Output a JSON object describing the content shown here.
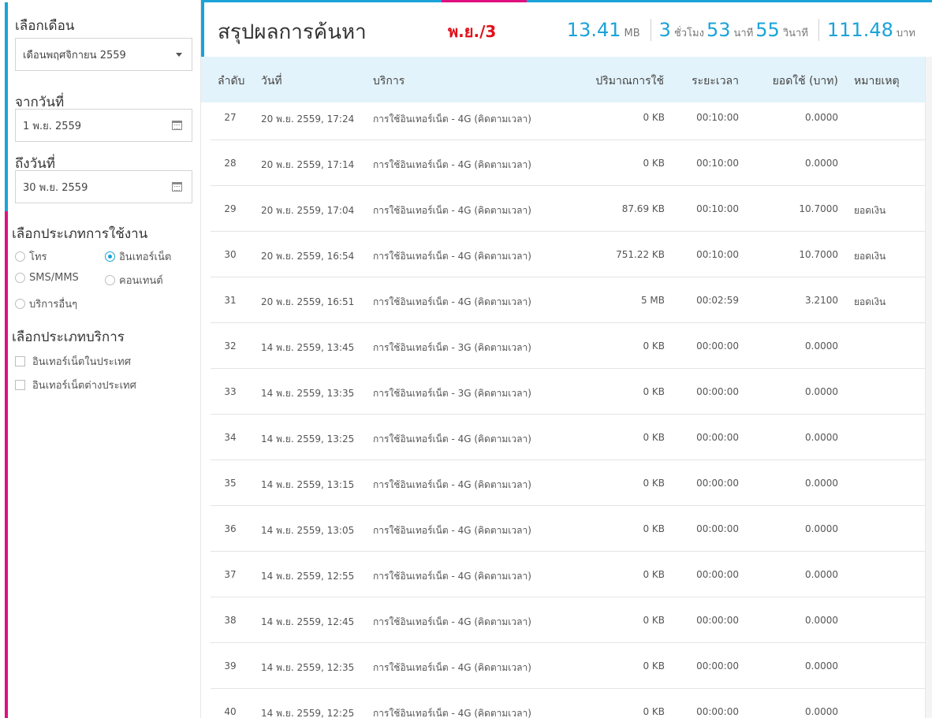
{
  "sidebar": {
    "month_label": "เลือกเดือน",
    "month_value": "เดือนพฤศจิกายน 2559",
    "from_label": "จากวันที่",
    "from_value": "1 พ.ย. 2559",
    "to_label": "ถึงวันที่",
    "to_value": "30 พ.ย. 2559",
    "usage_type_label": "เลือกประเภทการใช้งาน",
    "usage_types": [
      {
        "label": "โทร",
        "selected": false
      },
      {
        "label": "อินเทอร์เน็ต",
        "selected": true
      },
      {
        "label": "SMS/MMS",
        "selected": false
      },
      {
        "label": "คอนเทนต์",
        "selected": false
      },
      {
        "label": "บริการอื่นๆ",
        "selected": false
      }
    ],
    "service_type_label": "เลือกประเภทบริการ",
    "service_types": [
      {
        "label": "อินเทอร์เน็ตในประเทศ",
        "checked": false
      },
      {
        "label": "อินเทอร์เน็ตต่างประเทศ",
        "checked": false
      }
    ]
  },
  "header": {
    "title": "สรุปผลการค้นหา",
    "month_tag": "พ.ย./3",
    "data_value": "13.41",
    "data_unit": "MB",
    "hours_value": "3",
    "hours_unit": "ชั่วโมง",
    "minutes_value": "53",
    "minutes_unit": "นาที",
    "seconds_value": "55",
    "seconds_unit": "วินาที",
    "cost_value": "111.48",
    "cost_unit": "บาท"
  },
  "table": {
    "headers": {
      "no": "ลำดับ",
      "date": "วันที่",
      "service": "บริการ",
      "amount": "ปริมาณการใช้",
      "duration": "ระยะเวลา",
      "cost": "ยอดใช้ (บาท)",
      "note": "หมายเหตุ"
    },
    "rows": [
      {
        "no": "27",
        "date": "20 พ.ย. 2559, 17:24",
        "service": "การใช้อินเทอร์เน็ต - 4G (คิดตามเวลา)",
        "amount": "0 KB",
        "duration": "00:10:00",
        "cost": "0.0000",
        "note": ""
      },
      {
        "no": "28",
        "date": "20 พ.ย. 2559, 17:14",
        "service": "การใช้อินเทอร์เน็ต - 4G (คิดตามเวลา)",
        "amount": "0 KB",
        "duration": "00:10:00",
        "cost": "0.0000",
        "note": ""
      },
      {
        "no": "29",
        "date": "20 พ.ย. 2559, 17:04",
        "service": "การใช้อินเทอร์เน็ต - 4G (คิดตามเวลา)",
        "amount": "87.69 KB",
        "duration": "00:10:00",
        "cost": "10.7000",
        "note": "ยอดเงิน"
      },
      {
        "no": "30",
        "date": "20 พ.ย. 2559, 16:54",
        "service": "การใช้อินเทอร์เน็ต - 4G (คิดตามเวลา)",
        "amount": "751.22 KB",
        "duration": "00:10:00",
        "cost": "10.7000",
        "note": "ยอดเงิน"
      },
      {
        "no": "31",
        "date": "20 พ.ย. 2559, 16:51",
        "service": "การใช้อินเทอร์เน็ต - 4G (คิดตามเวลา)",
        "amount": "5 MB",
        "duration": "00:02:59",
        "cost": "3.2100",
        "note": "ยอดเงิน"
      },
      {
        "no": "32",
        "date": "14 พ.ย. 2559, 13:45",
        "service": "การใช้อินเทอร์เน็ต - 3G (คิดตามเวลา)",
        "amount": "0 KB",
        "duration": "00:00:00",
        "cost": "0.0000",
        "note": ""
      },
      {
        "no": "33",
        "date": "14 พ.ย. 2559, 13:35",
        "service": "การใช้อินเทอร์เน็ต - 3G (คิดตามเวลา)",
        "amount": "0 KB",
        "duration": "00:00:00",
        "cost": "0.0000",
        "note": ""
      },
      {
        "no": "34",
        "date": "14 พ.ย. 2559, 13:25",
        "service": "การใช้อินเทอร์เน็ต - 4G (คิดตามเวลา)",
        "amount": "0 KB",
        "duration": "00:00:00",
        "cost": "0.0000",
        "note": ""
      },
      {
        "no": "35",
        "date": "14 พ.ย. 2559, 13:15",
        "service": "การใช้อินเทอร์เน็ต - 4G (คิดตามเวลา)",
        "amount": "0 KB",
        "duration": "00:00:00",
        "cost": "0.0000",
        "note": ""
      },
      {
        "no": "36",
        "date": "14 พ.ย. 2559, 13:05",
        "service": "การใช้อินเทอร์เน็ต - 4G (คิดตามเวลา)",
        "amount": "0 KB",
        "duration": "00:00:00",
        "cost": "0.0000",
        "note": ""
      },
      {
        "no": "37",
        "date": "14 พ.ย. 2559, 12:55",
        "service": "การใช้อินเทอร์เน็ต - 4G (คิดตามเวลา)",
        "amount": "0 KB",
        "duration": "00:00:00",
        "cost": "0.0000",
        "note": ""
      },
      {
        "no": "38",
        "date": "14 พ.ย. 2559, 12:45",
        "service": "การใช้อินเทอร์เน็ต - 4G (คิดตามเวลา)",
        "amount": "0 KB",
        "duration": "00:00:00",
        "cost": "0.0000",
        "note": ""
      },
      {
        "no": "39",
        "date": "14 พ.ย. 2559, 12:35",
        "service": "การใช้อินเทอร์เน็ต - 4G (คิดตามเวลา)",
        "amount": "0 KB",
        "duration": "00:00:00",
        "cost": "0.0000",
        "note": ""
      },
      {
        "no": "40",
        "date": "14 พ.ย. 2559, 12:25",
        "service": "การใช้อินเทอร์เน็ต - 4G (คิดตามเวลา)",
        "amount": "0 KB",
        "duration": "00:00:00",
        "cost": "0.0000",
        "note": ""
      }
    ]
  },
  "colors": {
    "accent": "#1aa3d9",
    "brand_pink": "#e0117f",
    "month_tag": "#e0111b",
    "header_bg": "#e3f3fb"
  },
  "icons": [
    "caret-down-icon",
    "calendar-icon",
    "radio-icon",
    "checkbox-icon"
  ]
}
